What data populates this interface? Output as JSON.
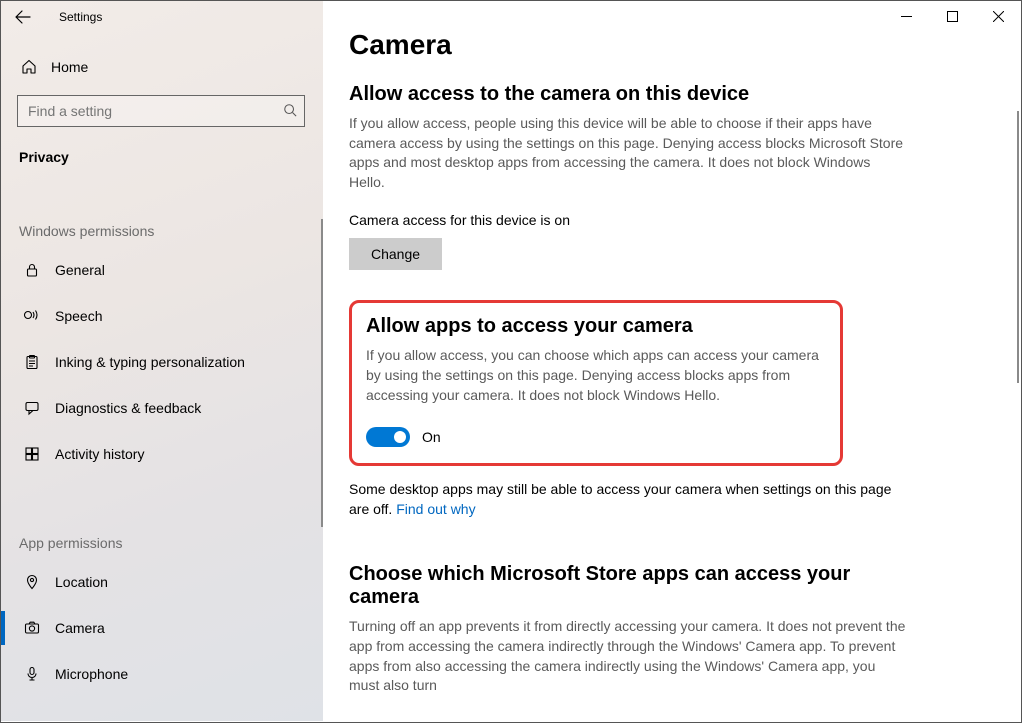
{
  "window": {
    "title": "Settings"
  },
  "sidebar": {
    "home_label": "Home",
    "search_placeholder": "Find a setting",
    "current_section": "Privacy",
    "group1_title": "Windows permissions",
    "group1_items": [
      {
        "label": "General"
      },
      {
        "label": "Speech"
      },
      {
        "label": "Inking & typing personalization"
      },
      {
        "label": "Diagnostics & feedback"
      },
      {
        "label": "Activity history"
      }
    ],
    "group2_title": "App permissions",
    "group2_items": [
      {
        "label": "Location"
      },
      {
        "label": "Camera"
      },
      {
        "label": "Microphone"
      }
    ]
  },
  "main": {
    "page_title": "Camera",
    "section1": {
      "title": "Allow access to the camera on this device",
      "desc": "If you allow access, people using this device will be able to choose if their apps have camera access by using the settings on this page. Denying access blocks Microsoft Store apps and most desktop apps from accessing the camera. It does not block Windows Hello.",
      "status": "Camera access for this device is on",
      "change_label": "Change"
    },
    "section2": {
      "title": "Allow apps to access your camera",
      "desc": "If you allow access, you can choose which apps can access your camera by using the settings on this page. Denying access blocks apps from accessing your camera. It does not block Windows Hello.",
      "toggle_state": "On",
      "note_text": "Some desktop apps may still be able to access your camera when settings on this page are off. ",
      "note_link": "Find out why"
    },
    "section3": {
      "title": "Choose which Microsoft Store apps can access your camera",
      "desc": "Turning off an app prevents it from directly accessing your camera. It does not prevent the app from accessing the camera indirectly through the Windows' Camera app. To prevent apps from also accessing the camera indirectly using the Windows' Camera app, you must also turn"
    }
  }
}
